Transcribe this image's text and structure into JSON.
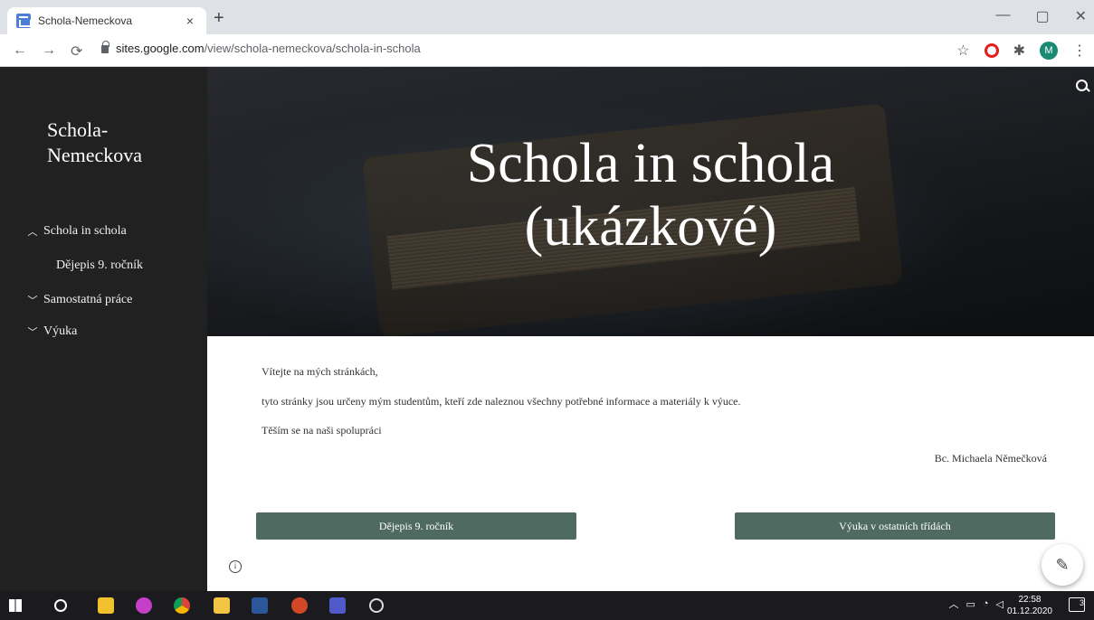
{
  "browser": {
    "tab_title": "Schola-Nemeckova",
    "tab_close": "×",
    "new_tab": "+",
    "url_domain": "sites.google.com",
    "url_path": "/view/schola-nemeckova/schola-in-schola",
    "avatar_initial": "M",
    "window_controls": [
      "—",
      "▢",
      "✕"
    ]
  },
  "sidebar": {
    "site_title_line1": "Schola-",
    "site_title_line2": "Nemeckova",
    "items": [
      {
        "label": "Schola in schola",
        "chevron": "up"
      },
      {
        "label": "Dějepis 9. ročník",
        "chevron": "none"
      },
      {
        "label": "Samostatná práce",
        "chevron": "down"
      },
      {
        "label": "Výuka",
        "chevron": "down"
      }
    ]
  },
  "hero": {
    "title_line1": "Schola in schola",
    "title_line2": "(ukázkové)"
  },
  "content": {
    "greeting": "Vítejte na mých stránkách,",
    "body": "tyto stránky jsou určeny mým studentům, kteří zde naleznou všechny potřebné informace a materiály k výuce.",
    "closing": "Těším se na naši spolupráci",
    "signature": "Bc. Michaela Němečková",
    "button_left": "Dějepis 9. ročník",
    "button_right": "Výuka v ostatních třídách"
  },
  "taskbar": {
    "time": "22:58",
    "date": "01.12.2020",
    "notifications": "3"
  },
  "colors": {
    "sidebar_bg": "#212121",
    "button_bg": "#4f6b61",
    "taskbar_bg": "#1b1b1f",
    "avatar_bg": "#1a8a74"
  }
}
